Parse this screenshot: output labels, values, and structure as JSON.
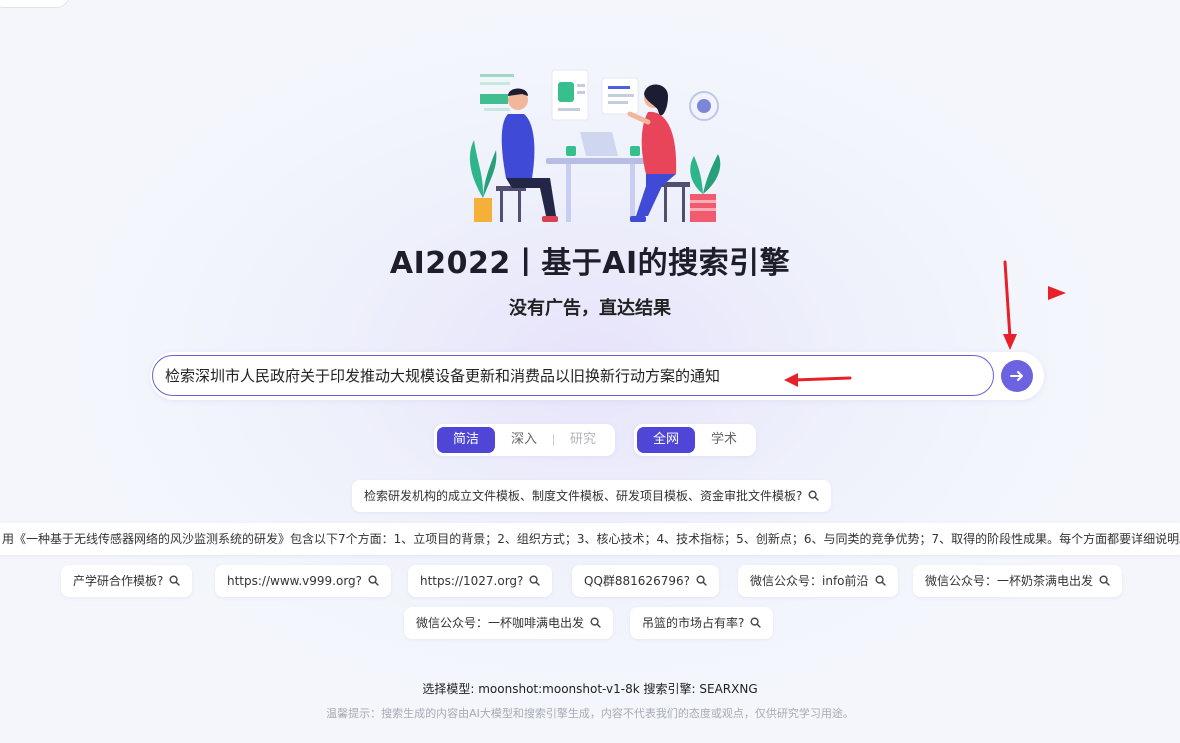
{
  "header": {
    "title": "AI2022丨基于AI的搜索引擎",
    "subtitle": "没有广告，直达结果"
  },
  "search": {
    "value": "检索深圳市人民政府关于印发推动大规模设备更新和消费品以旧换新行动方案的通知",
    "submit_icon": "arrow-right-icon"
  },
  "modes": {
    "depth": [
      {
        "label": "简洁",
        "active": true
      },
      {
        "label": "深入",
        "active": false
      },
      {
        "label": "研究",
        "active": false
      }
    ],
    "scope": [
      {
        "label": "全网",
        "active": true
      },
      {
        "label": "学术",
        "active": false
      }
    ]
  },
  "suggestions": [
    "检索研发机构的成立文件模板、制度文件模板、研发项目模板、资金审批文件模板?",
    "用《一种基于无线传感器网络的风沙监测系统的研发》包含以下7个方面：1、立项目的背景；2、组织方式；3、核心技术；4、技术指标；5、创新点；6、与同类的竞争优势；7、取得的阶段性成果。每个方面都要详细说明。",
    "产学研合作模板?",
    "https://www.v999.org?",
    "https://1027.org?",
    "QQ群881626796?",
    "微信公众号：info前沿",
    "微信公众号：一杯奶茶满电出发",
    "微信公众号：一杯咖啡满电出发",
    "吊篮的市场占有率?"
  ],
  "footer": {
    "model": "选择模型: moonshot:moonshot-v1-8k  搜索引擎: SEARXNG",
    "tip": "温馨提示：搜索生成的内容由AI大模型和搜索引擎生成，内容不代表我们的态度或观点，仅供研究学习用途。"
  },
  "colors": {
    "accent": "#4f46d8",
    "button": "#6b63e0",
    "annotation": "#e8202a"
  }
}
